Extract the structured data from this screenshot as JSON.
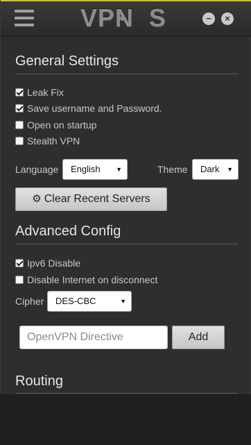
{
  "app": {
    "title": "VPN·S",
    "title_left": "VPN",
    "title_right": "S",
    "menu_icon": "hamburger-icon",
    "minimize_glyph": "−",
    "close_glyph": "×"
  },
  "general": {
    "heading": "General Settings",
    "options": [
      {
        "label": "Leak Fix",
        "checked": true
      },
      {
        "label": "Save username and Password.",
        "checked": true
      },
      {
        "label": "Open on startup",
        "checked": false
      },
      {
        "label": "Stealth VPN",
        "checked": false
      }
    ],
    "language_label": "Language",
    "language_value": "English",
    "theme_label": "Theme",
    "theme_value": "Dark",
    "clear_button_label": "Clear Recent Servers",
    "clear_button_icon": "gear-icon"
  },
  "advanced": {
    "heading": "Advanced Config",
    "options": [
      {
        "label": "Ipv6 Disable",
        "checked": true
      },
      {
        "label": "Disable Internet on disconnect",
        "checked": false
      }
    ],
    "cipher_label": "Cipher",
    "cipher_value": "DES-CBC",
    "directive_placeholder": "OpenVPN Directive",
    "add_button_label": "Add"
  },
  "routing": {
    "heading": "Routing"
  },
  "colors": {
    "accent_bar": "#d6c800",
    "panel_bg": "#2e2e2e",
    "text": "#c8c8c8"
  }
}
